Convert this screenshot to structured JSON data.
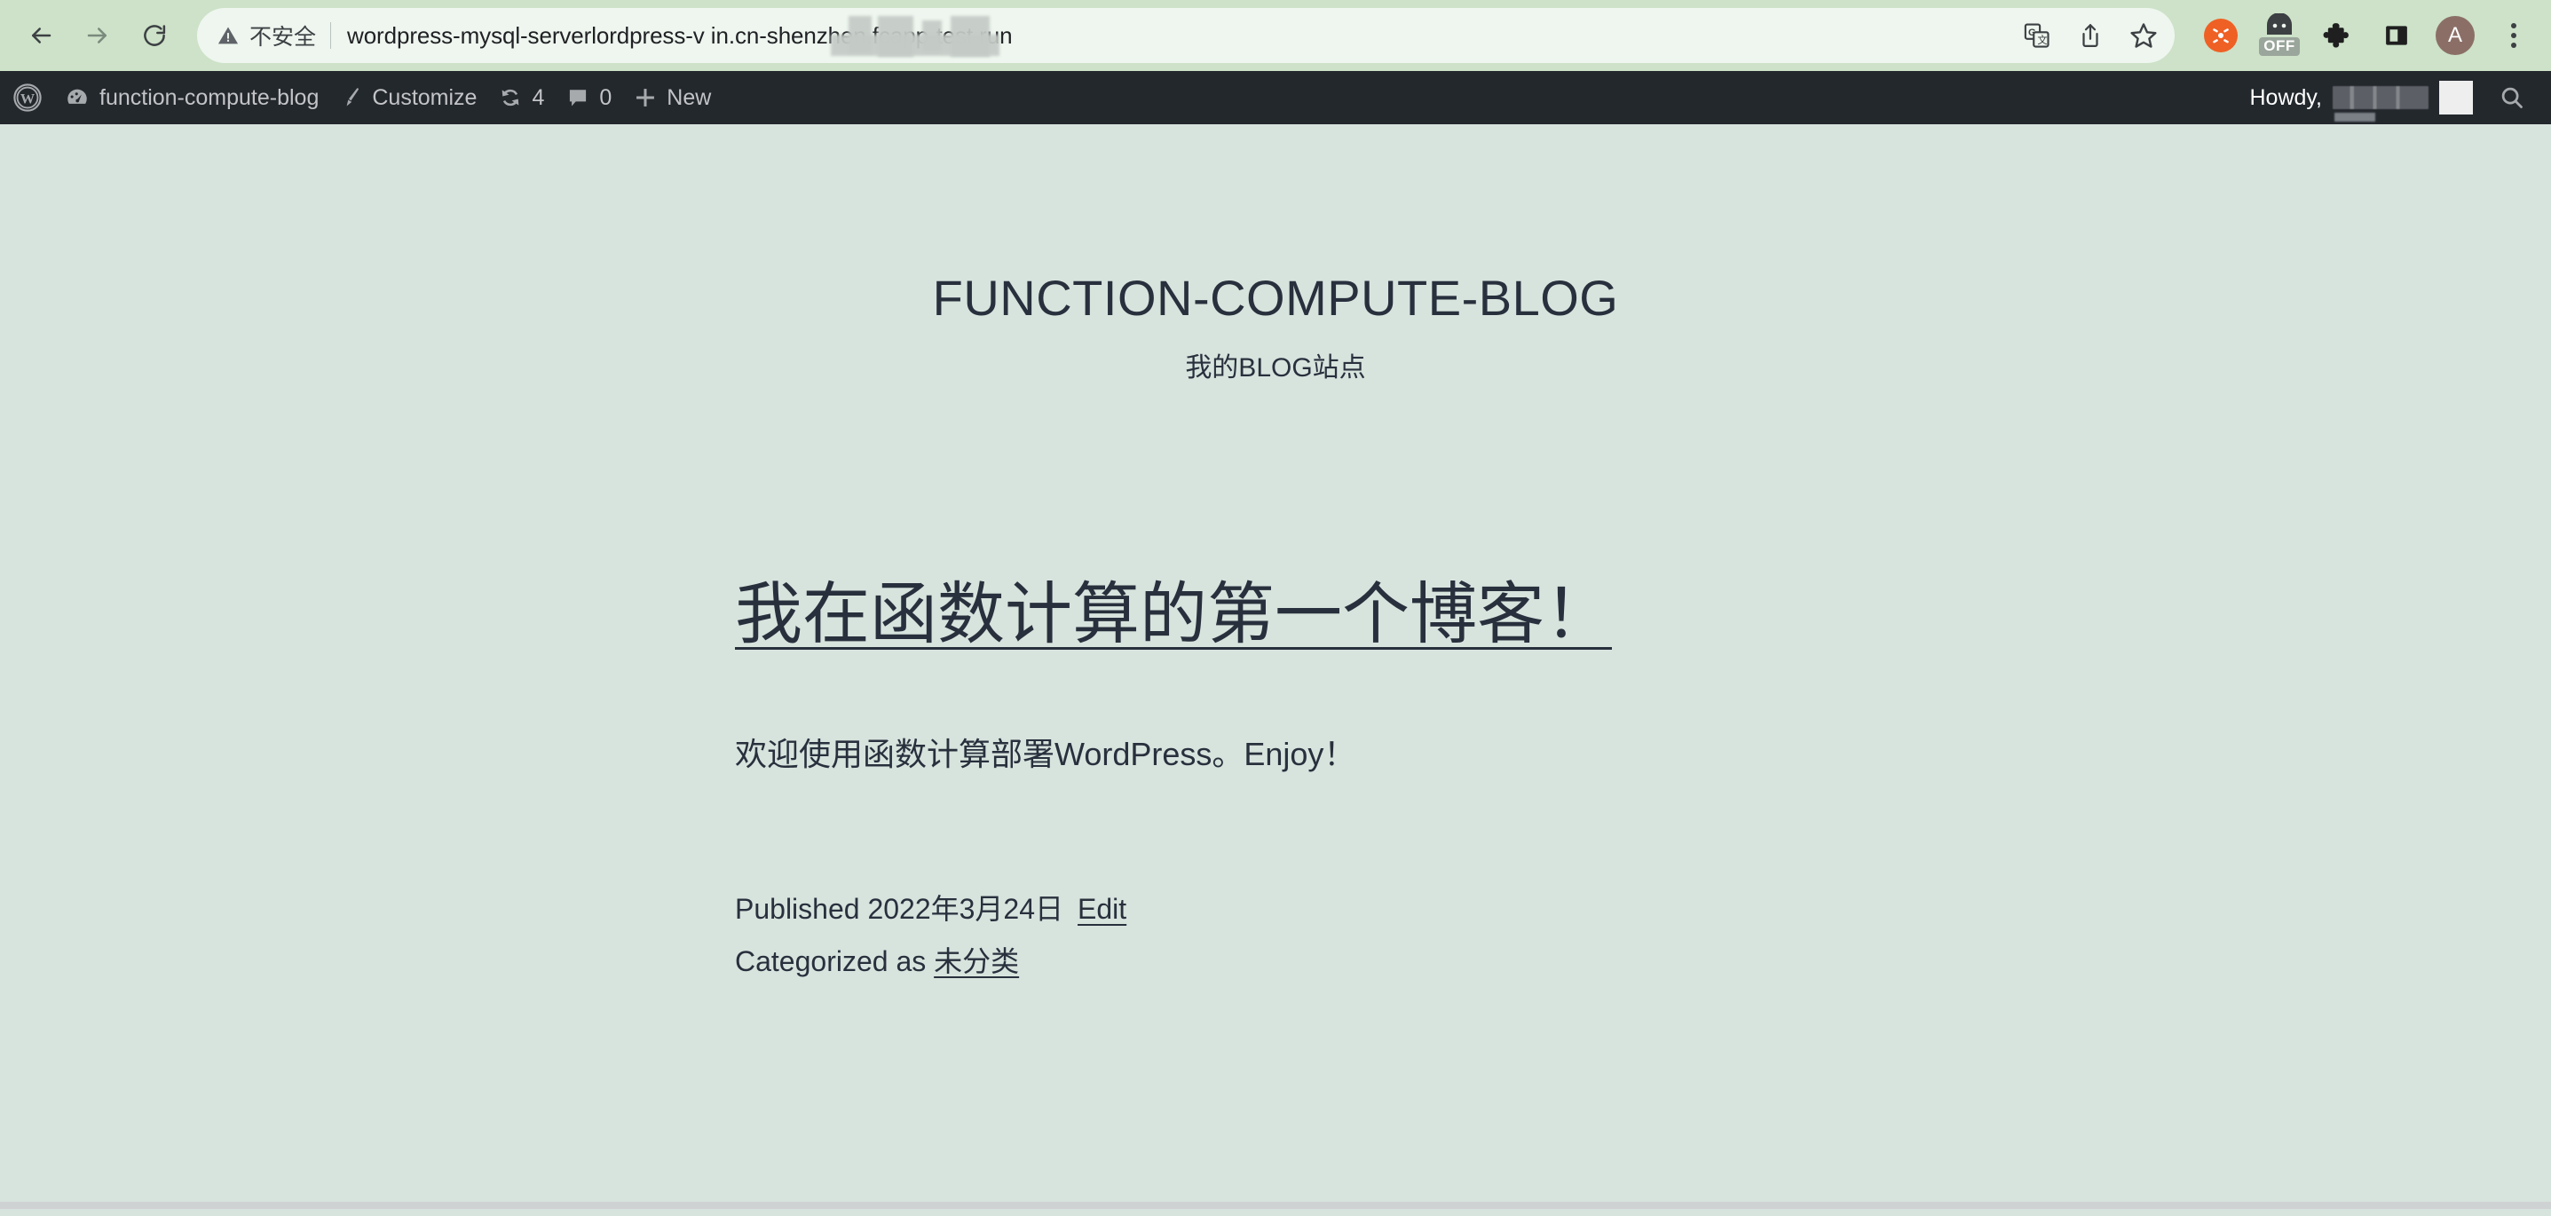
{
  "browser": {
    "back_icon": "arrow-left-icon",
    "forward_icon": "arrow-right-icon",
    "reload_icon": "reload-icon",
    "security_label": "不安全",
    "security_icon": "warning-triangle-icon",
    "url": "wordpress-mysql-serverlordpress-v          in.cn-shenzhen.fcapp-test.run",
    "url_prefix": "wordpress-mysql-serverlordpress-v",
    "url_suffix": "in.cn-shenzhen.fcapp-test.run",
    "translate_icon": "translate-icon",
    "share_icon": "share-icon",
    "bookmark_icon": "star-icon",
    "extension_orange_icon": "extension-orange-icon",
    "extension_off_icon": "extension-off-icon",
    "extension_off_label": "OFF",
    "extensions_icon": "puzzle-piece-icon",
    "sidepanel_icon": "side-panel-icon",
    "profile_initial": "A",
    "menu_icon": "three-dot-menu-icon",
    "toolbar_bg": "#cde2c8",
    "omnibox_bg": "#eef6ef"
  },
  "adminbar": {
    "wp_logo_icon": "wordpress-logo-icon",
    "dashboard_icon": "dashboard-gauge-icon",
    "site_name": "function-compute-blog",
    "customize_icon": "paintbrush-icon",
    "customize_label": "Customize",
    "updates_icon": "updates-refresh-icon",
    "updates_count": "4",
    "comments_icon": "comment-bubble-icon",
    "comments_count": "0",
    "new_icon": "plus-icon",
    "new_label": "New",
    "howdy_label": "Howdy,",
    "howdy_name_redacted": "",
    "avatar_name": "user-avatar",
    "search_icon": "search-icon",
    "bg": "#23282d"
  },
  "site": {
    "title": "FUNCTION-COMPUTE-BLOG",
    "tagline": "我的BLOG站点",
    "bg": "#d7e3dd",
    "text_color": "#28303d"
  },
  "post": {
    "title": "我在函数计算的第一个博客！",
    "body": "欢迎使用函数计算部署WordPress。Enjoy！",
    "published_label": "Published 2022年3月24日",
    "edit_link": "Edit",
    "categorized_label": "Categorized as",
    "category_link": "未分类"
  }
}
